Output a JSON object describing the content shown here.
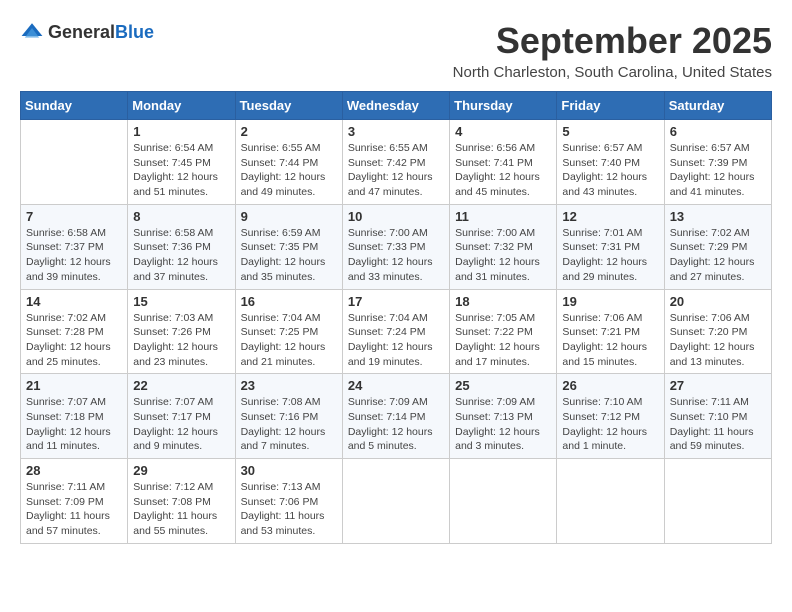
{
  "logo": {
    "general": "General",
    "blue": "Blue"
  },
  "title": "September 2025",
  "location": "North Charleston, South Carolina, United States",
  "weekdays": [
    "Sunday",
    "Monday",
    "Tuesday",
    "Wednesday",
    "Thursday",
    "Friday",
    "Saturday"
  ],
  "weeks": [
    [
      {
        "day": "",
        "info": ""
      },
      {
        "day": "1",
        "info": "Sunrise: 6:54 AM\nSunset: 7:45 PM\nDaylight: 12 hours\nand 51 minutes."
      },
      {
        "day": "2",
        "info": "Sunrise: 6:55 AM\nSunset: 7:44 PM\nDaylight: 12 hours\nand 49 minutes."
      },
      {
        "day": "3",
        "info": "Sunrise: 6:55 AM\nSunset: 7:42 PM\nDaylight: 12 hours\nand 47 minutes."
      },
      {
        "day": "4",
        "info": "Sunrise: 6:56 AM\nSunset: 7:41 PM\nDaylight: 12 hours\nand 45 minutes."
      },
      {
        "day": "5",
        "info": "Sunrise: 6:57 AM\nSunset: 7:40 PM\nDaylight: 12 hours\nand 43 minutes."
      },
      {
        "day": "6",
        "info": "Sunrise: 6:57 AM\nSunset: 7:39 PM\nDaylight: 12 hours\nand 41 minutes."
      }
    ],
    [
      {
        "day": "7",
        "info": "Sunrise: 6:58 AM\nSunset: 7:37 PM\nDaylight: 12 hours\nand 39 minutes."
      },
      {
        "day": "8",
        "info": "Sunrise: 6:58 AM\nSunset: 7:36 PM\nDaylight: 12 hours\nand 37 minutes."
      },
      {
        "day": "9",
        "info": "Sunrise: 6:59 AM\nSunset: 7:35 PM\nDaylight: 12 hours\nand 35 minutes."
      },
      {
        "day": "10",
        "info": "Sunrise: 7:00 AM\nSunset: 7:33 PM\nDaylight: 12 hours\nand 33 minutes."
      },
      {
        "day": "11",
        "info": "Sunrise: 7:00 AM\nSunset: 7:32 PM\nDaylight: 12 hours\nand 31 minutes."
      },
      {
        "day": "12",
        "info": "Sunrise: 7:01 AM\nSunset: 7:31 PM\nDaylight: 12 hours\nand 29 minutes."
      },
      {
        "day": "13",
        "info": "Sunrise: 7:02 AM\nSunset: 7:29 PM\nDaylight: 12 hours\nand 27 minutes."
      }
    ],
    [
      {
        "day": "14",
        "info": "Sunrise: 7:02 AM\nSunset: 7:28 PM\nDaylight: 12 hours\nand 25 minutes."
      },
      {
        "day": "15",
        "info": "Sunrise: 7:03 AM\nSunset: 7:26 PM\nDaylight: 12 hours\nand 23 minutes."
      },
      {
        "day": "16",
        "info": "Sunrise: 7:04 AM\nSunset: 7:25 PM\nDaylight: 12 hours\nand 21 minutes."
      },
      {
        "day": "17",
        "info": "Sunrise: 7:04 AM\nSunset: 7:24 PM\nDaylight: 12 hours\nand 19 minutes."
      },
      {
        "day": "18",
        "info": "Sunrise: 7:05 AM\nSunset: 7:22 PM\nDaylight: 12 hours\nand 17 minutes."
      },
      {
        "day": "19",
        "info": "Sunrise: 7:06 AM\nSunset: 7:21 PM\nDaylight: 12 hours\nand 15 minutes."
      },
      {
        "day": "20",
        "info": "Sunrise: 7:06 AM\nSunset: 7:20 PM\nDaylight: 12 hours\nand 13 minutes."
      }
    ],
    [
      {
        "day": "21",
        "info": "Sunrise: 7:07 AM\nSunset: 7:18 PM\nDaylight: 12 hours\nand 11 minutes."
      },
      {
        "day": "22",
        "info": "Sunrise: 7:07 AM\nSunset: 7:17 PM\nDaylight: 12 hours\nand 9 minutes."
      },
      {
        "day": "23",
        "info": "Sunrise: 7:08 AM\nSunset: 7:16 PM\nDaylight: 12 hours\nand 7 minutes."
      },
      {
        "day": "24",
        "info": "Sunrise: 7:09 AM\nSunset: 7:14 PM\nDaylight: 12 hours\nand 5 minutes."
      },
      {
        "day": "25",
        "info": "Sunrise: 7:09 AM\nSunset: 7:13 PM\nDaylight: 12 hours\nand 3 minutes."
      },
      {
        "day": "26",
        "info": "Sunrise: 7:10 AM\nSunset: 7:12 PM\nDaylight: 12 hours\nand 1 minute."
      },
      {
        "day": "27",
        "info": "Sunrise: 7:11 AM\nSunset: 7:10 PM\nDaylight: 11 hours\nand 59 minutes."
      }
    ],
    [
      {
        "day": "28",
        "info": "Sunrise: 7:11 AM\nSunset: 7:09 PM\nDaylight: 11 hours\nand 57 minutes."
      },
      {
        "day": "29",
        "info": "Sunrise: 7:12 AM\nSunset: 7:08 PM\nDaylight: 11 hours\nand 55 minutes."
      },
      {
        "day": "30",
        "info": "Sunrise: 7:13 AM\nSunset: 7:06 PM\nDaylight: 11 hours\nand 53 minutes."
      },
      {
        "day": "",
        "info": ""
      },
      {
        "day": "",
        "info": ""
      },
      {
        "day": "",
        "info": ""
      },
      {
        "day": "",
        "info": ""
      }
    ]
  ]
}
